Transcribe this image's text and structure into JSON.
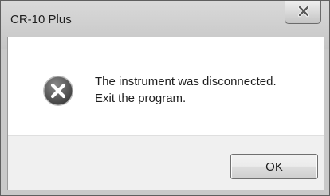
{
  "window": {
    "title": "CR-10 Plus"
  },
  "dialog": {
    "icon": "error-x-icon",
    "message_lines": [
      "The instrument was disconnected.",
      "Exit the program."
    ],
    "ok_label": "OK"
  },
  "colors": {
    "title_bar": "#cfcfcf",
    "window_frame": "#c9c9c9",
    "footer": "#f0f0f0",
    "error_icon_fill": "#4d4d4d"
  }
}
